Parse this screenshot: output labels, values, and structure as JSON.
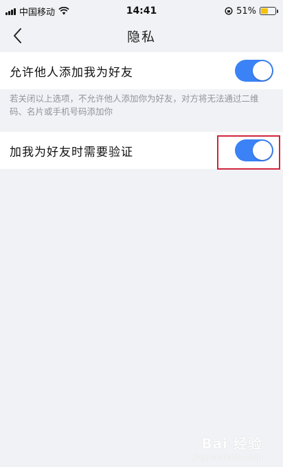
{
  "status_bar": {
    "carrier": "中国移动",
    "time": "14:41",
    "battery_percent": "51%",
    "battery_level": 0.51,
    "wifi_icon": "wifi-icon",
    "lock_icon": "rotation-lock-icon"
  },
  "nav": {
    "title": "隐私",
    "back_icon": "chevron-left-icon"
  },
  "settings": [
    {
      "label": "允许他人添加我为好友",
      "enabled": true
    },
    {
      "label": "加我为好友时需要验证",
      "enabled": true
    }
  ],
  "hint_text": "若关闭以上选项，不允许他人添加你为好友，对方将无法通过二维码、名片或手机号码添加你",
  "accent_color": "#3a82f6",
  "highlight_color": "#d0243a",
  "watermark": {
    "logo": "Bai 经验",
    "url": "jingyan.baidu.com"
  }
}
